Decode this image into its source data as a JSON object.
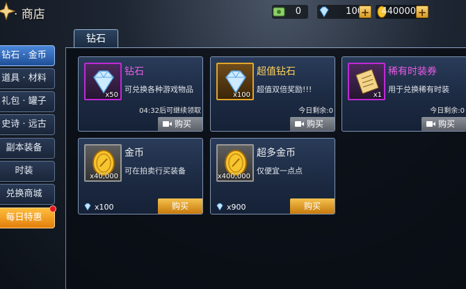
{
  "header": {
    "title": "· 商店"
  },
  "resources": {
    "cash": "0",
    "gems": "100",
    "gold": "440000",
    "plus": "+"
  },
  "sidebar": {
    "items": [
      {
        "label": "钻石 · 金币",
        "state": "active"
      },
      {
        "label": "道具 · 材料",
        "state": "normal"
      },
      {
        "label": "礼包 · 罐子",
        "state": "normal"
      },
      {
        "label": "史诗 · 远古",
        "state": "normal"
      },
      {
        "label": "副本装备",
        "state": "normal"
      },
      {
        "label": "时装",
        "state": "normal"
      },
      {
        "label": "兑换商城",
        "state": "normal"
      },
      {
        "label": "每日特惠",
        "state": "special",
        "badge": "red-dot"
      }
    ]
  },
  "tab": {
    "label": "钻石"
  },
  "cards": [
    {
      "name": "钻石",
      "name_color": "#e95de6",
      "icon": "diamond-icon",
      "frame": "purple",
      "qty": "x50",
      "desc": "可兑换各种游戏物品",
      "note": "04:32后可继续领取",
      "button": "购买",
      "button_type": "video"
    },
    {
      "name": "超值钻石",
      "name_color": "#ffd15a",
      "icon": "diamond-icon",
      "frame": "gold",
      "qty": "x100",
      "desc": "超值双倍奖励!!!",
      "note": "今日剩余:0",
      "button": "购买",
      "button_type": "video"
    },
    {
      "name": "稀有时装券",
      "name_color": "#e95de6",
      "icon": "scroll-icon",
      "frame": "purple",
      "qty": "x1",
      "desc": "用于兑换稀有时装",
      "note": "今日剩余:0",
      "button": "购买",
      "button_type": "video"
    },
    {
      "name": "金币",
      "name_color": "#f0f0f0",
      "icon": "gold-coin-icon",
      "frame": "grey",
      "qty": "x40,000",
      "desc": "可在拍卖行买装备",
      "price": "x100",
      "button": "购买",
      "button_type": "buy"
    },
    {
      "name": "超多金币",
      "name_color": "#f0f0f0",
      "icon": "gold-coin-icon",
      "frame": "grey",
      "qty": "x400,000",
      "desc": "仅便宜一点点",
      "price": "x900",
      "button": "购买",
      "button_type": "buy"
    }
  ],
  "colors": {
    "accent": "#4a86d8",
    "gold": "#ffd15a",
    "magenta": "#e95de6",
    "special": "#f09a20"
  }
}
